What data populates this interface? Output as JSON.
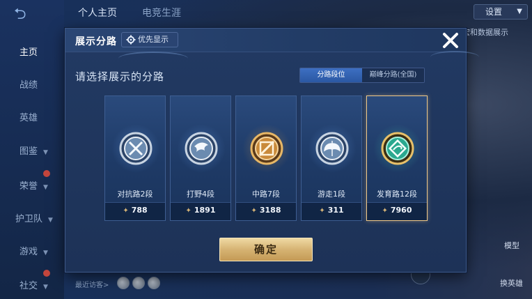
{
  "background": {
    "back_glyph": "⮌",
    "top_nav": [
      "个人主页",
      "电竞生涯"
    ],
    "sidebar": [
      {
        "label": "主页",
        "active": true
      },
      {
        "label": "战绩",
        "active": false
      },
      {
        "label": "英雄",
        "active": false
      },
      {
        "label": "图鉴",
        "active": false
      },
      {
        "label": "荣誉",
        "active": false
      },
      {
        "label": "护卫队",
        "active": false
      },
      {
        "label": "游戏",
        "active": false
      },
      {
        "label": "社交",
        "active": false
      }
    ],
    "settings_label": "设置",
    "data_show_label": "宏和数据展示",
    "visitor_label": "最近访客>",
    "model_label": "模型",
    "swap_hero_label": "换英雄"
  },
  "modal": {
    "title": "展示分路",
    "priority_button": "优先显示",
    "subtitle": "请选择展示的分路",
    "toggle": [
      {
        "label": "分路段位",
        "active": true
      },
      {
        "label": "巅峰分路(全国)",
        "active": false
      }
    ],
    "cards": [
      {
        "label": "对抗路2段",
        "score": "788",
        "icon": "crossed-swords-emblem",
        "selected": false,
        "color": "#b8c7d8"
      },
      {
        "label": "打野4段",
        "score": "1891",
        "icon": "dragon-emblem",
        "selected": false,
        "color": "#b8c7d8"
      },
      {
        "label": "中路7段",
        "score": "3188",
        "icon": "slash-emblem",
        "selected": false,
        "color": "#d8a352"
      },
      {
        "label": "游走1段",
        "score": "311",
        "icon": "wings-emblem",
        "selected": false,
        "color": "#b8c7d8"
      },
      {
        "label": "发育路12段",
        "score": "7960",
        "icon": "arrow-emblem",
        "selected": true,
        "color": "#3fd1b5"
      }
    ],
    "confirm_button": "确定"
  },
  "colors": {
    "accent_gold": "#d6b373",
    "selected_border": "#f0c988",
    "modal_bg": "#223a63",
    "toggle_active": "#3d6fc2"
  }
}
